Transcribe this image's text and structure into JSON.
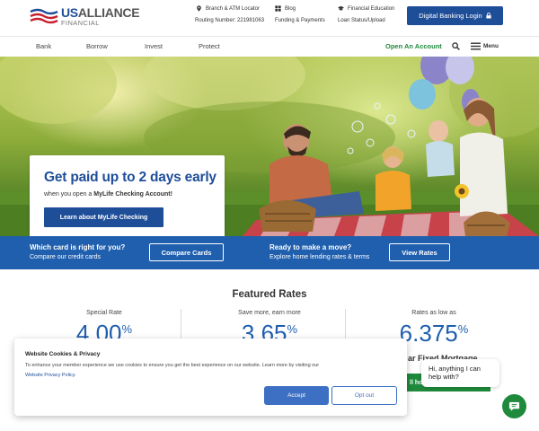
{
  "brand": {
    "logo_us": "US",
    "logo_alliance": "ALLIANCE",
    "logo_financial": "FINANCIAL",
    "accent": "#1f4e99",
    "green": "#1f8a3c"
  },
  "utility": {
    "branch": "Branch & ATM Locator",
    "routing": "Routing Number: 221981063",
    "blog": "Blog",
    "funding": "Funding & Payments",
    "education": "Financial Education",
    "loan_status": "Loan Status/Upload",
    "login_button": "Digital Banking Login"
  },
  "nav": {
    "items": [
      "Bank",
      "Borrow",
      "Invest",
      "Protect"
    ],
    "open_account": "Open An Account",
    "menu": "Menu"
  },
  "hero": {
    "headline": "Get paid up to 2 days early",
    "sub_prefix": "when you open a ",
    "sub_bold": "MyLife Checking Account!",
    "button": "Learn about MyLife Checking"
  },
  "band": {
    "left_heading": "Which card is right for you?",
    "left_sub": "Compare our credit cards",
    "left_button": "Compare Cards",
    "right_heading": "Ready to make a move?",
    "right_sub": "Explore home lending rates & terms",
    "right_button": "View Rates"
  },
  "rates": {
    "title": "Featured Rates",
    "cols": [
      {
        "label": "Special Rate",
        "value": "4.00",
        "unit": "%"
      },
      {
        "label": "Save more, earn more",
        "value": "3.65",
        "unit": "%"
      },
      {
        "label": "Rates as low as",
        "value": "6.375",
        "unit": "%"
      }
    ],
    "sub_title_partial": "ar Fixed Mortgage",
    "green_button_partial": "ll ho"
  },
  "cookie": {
    "title": "Website Cookies & Privacy",
    "text": "To enhance your member experience we use cookies to ensure you get the best experience on our website. Learn more by visiting our",
    "link": "Website Privacy Policy.",
    "accept": "Accept",
    "opt_out": "Opt out"
  },
  "chat": {
    "greeting": "Hi, anything I can help with?"
  }
}
